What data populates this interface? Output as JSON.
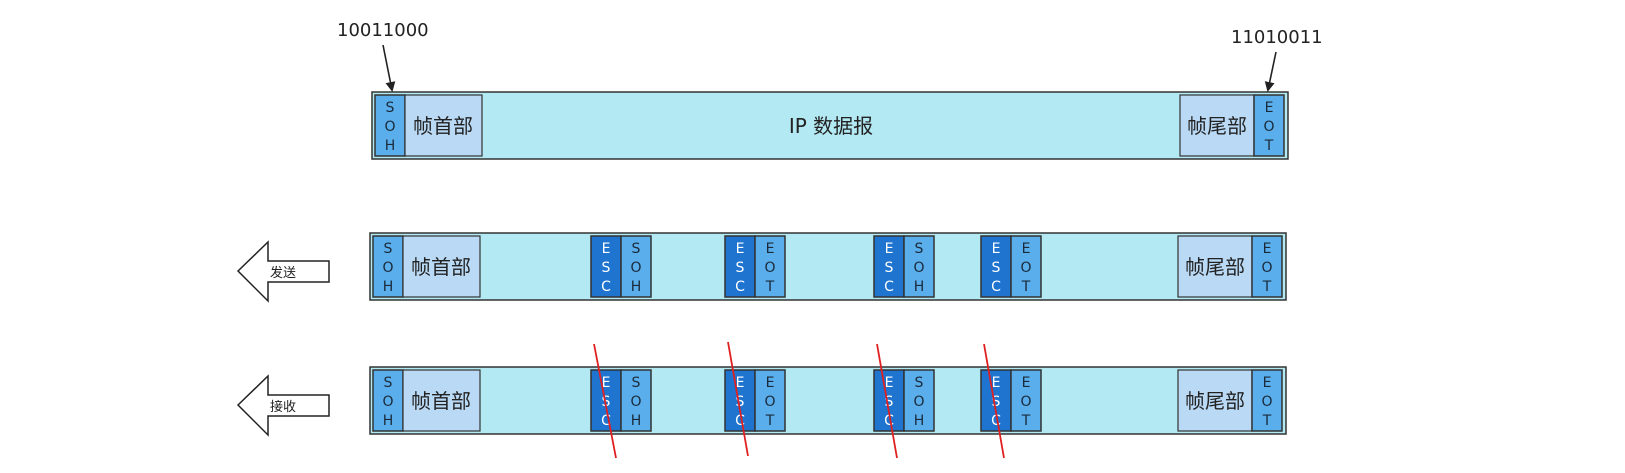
{
  "annotations": {
    "start_code": "10011000",
    "end_code": "11010011"
  },
  "frame_parts": {
    "header": "帧首部",
    "trailer": "帧尾部",
    "payload": "IP 数据报"
  },
  "control_chars": {
    "soh": "SOH",
    "eot": "EOT",
    "esc": "ESC"
  },
  "direction_labels": {
    "send": "发送",
    "receive": "接收"
  },
  "colors": {
    "frame_border": "#333333",
    "header_fill": "#b9d9f5",
    "payload_fill": "#b3e9f2",
    "ctrl_fill": "#5aaeeb",
    "esc_fill": "#1f74d0",
    "strike": "#e02020"
  }
}
